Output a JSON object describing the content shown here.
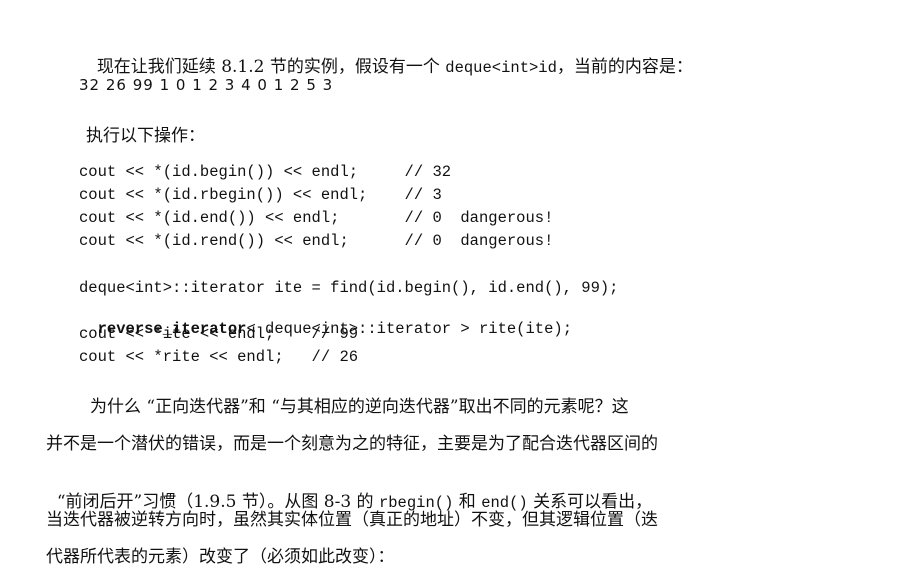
{
  "intro": {
    "prefix": "现在让我们延续 8.1.2 节的实例，假设有一个 ",
    "code": "deque<int>id",
    "suffix": "，当前的内容是："
  },
  "sequence": "32 26 99 1 0 1 2 3 4 0 1 2 5 3",
  "ops_heading": "执行以下操作：",
  "code_block1": [
    "cout << *(id.begin()) << endl;     // 32",
    "cout << *(id.rbegin()) << endl;    // 3",
    "cout << *(id.end()) << endl;       // 0  dangerous!",
    "cout << *(id.rend()) << endl;      // 0  dangerous!"
  ],
  "code_block2": {
    "line1": "deque<int>::iterator ite = find(id.begin(), id.end(), 99);",
    "line2_bold": "reverse_iterator",
    "line2_rest": "< deque<int>::iterator > rite(ite);",
    "line3": "cout << *ite << endl;    // 99",
    "line4": "cout << *rite << endl;   // 26"
  },
  "paragraph": {
    "line1": "为什么 “正向迭代器”和 “与其相应的逆向迭代器”取出不同的元素呢？这",
    "line2": "并不是一个潜伏的错误，而是一个刻意为之的特征，主要是为了配合迭代器区间的",
    "line3_a": "“前闭后开”习惯（1.9.5 节）。从图 8-3 的 ",
    "line3_code1": "rbegin()",
    "line3_b": " 和 ",
    "line3_code2": "end()",
    "line3_c": " 关系可以看出，",
    "line4": "当迭代器被逆转方向时，虽然其实体位置（真正的地址）不变，但其逻辑位置（迭",
    "line5": "代器所代表的元素）改变了（必须如此改变）："
  }
}
